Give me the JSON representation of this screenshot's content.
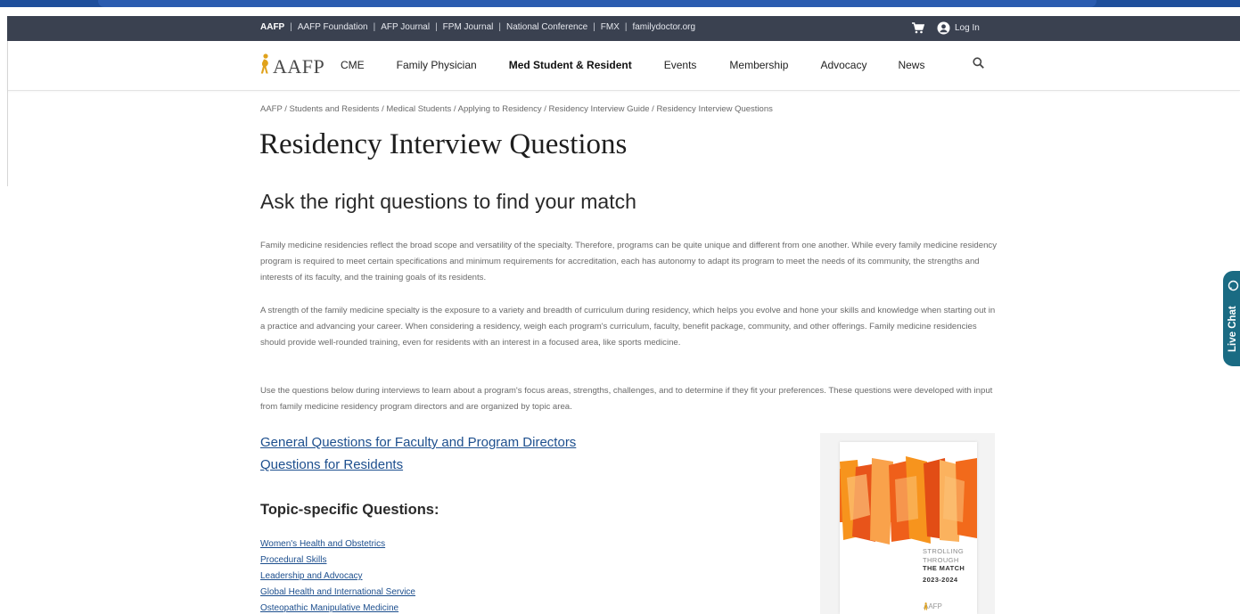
{
  "utility_bar": {
    "links": [
      "AAFP",
      "AAFP Foundation",
      "AFP Journal",
      "FPM Journal",
      "National Conference",
      "FMX",
      "familydoctor.org"
    ],
    "login_label": "Log In"
  },
  "nav": {
    "logo_text": "AAFP",
    "items": [
      "CME",
      "Family Physician",
      "Med Student & Resident",
      "Events",
      "Membership",
      "Advocacy",
      "News"
    ],
    "active_index": 2
  },
  "breadcrumb": "AAFP / Students and Residents / Medical Students / Applying to Residency / Residency Interview Guide / Residency Interview Questions",
  "page_title": "Residency Interview Questions",
  "subheading": "Ask the right questions to find your match",
  "paragraphs": [
    "Family medicine residencies reflect the broad scope and versatility of the specialty. Therefore, programs can be quite unique and different from one another. While every family medicine residency program is required to meet certain specifications and minimum requirements for accreditation, each has autonomy to adapt its program to meet the needs of its community, the strengths and interests of its faculty, and the training goals of its residents.",
    "A strength of the family medicine specialty is the exposure to a variety and breadth of curriculum during residency, which helps you evolve and hone your skills and knowledge when starting out in a practice and advancing your career. When considering a residency, weigh each program's curriculum, faculty, benefit package, community, and other offerings. Family medicine residencies should provide well-rounded training, even for residents with an interest in a focused area, like sports medicine.",
    "Use the questions below during interviews to learn about a program's focus areas, strengths, challenges, and to determine if they fit your preferences. These questions were developed with input from family medicine residency program directors and are organized by topic area."
  ],
  "main_links": [
    "General Questions for Faculty and Program Directors",
    "Questions for Residents"
  ],
  "topic_heading": "Topic-specific Questions:",
  "topic_links": [
    "Women's Health and Obstetrics",
    "Procedural Skills",
    "Leadership and Advocacy",
    "Global Health and International Service",
    "Osteopathic Manipulative Medicine"
  ],
  "cover": {
    "line1": "STROLLING",
    "line2": "THROUGH",
    "line3": "THE MATCH",
    "line4": "2023-2024",
    "logo": "AAFP"
  },
  "live_chat_label": "Live Chat",
  "colors": {
    "utility_bar": "#3a4150",
    "link": "#1d4f8e",
    "live_chat": "#1a6b83",
    "cover_orange": "#f26a1b",
    "logo_gold": "#e0a21b"
  },
  "icons": [
    "cart-icon",
    "user-icon",
    "search-icon",
    "chat-icon",
    "aafp-figure-icon"
  ]
}
